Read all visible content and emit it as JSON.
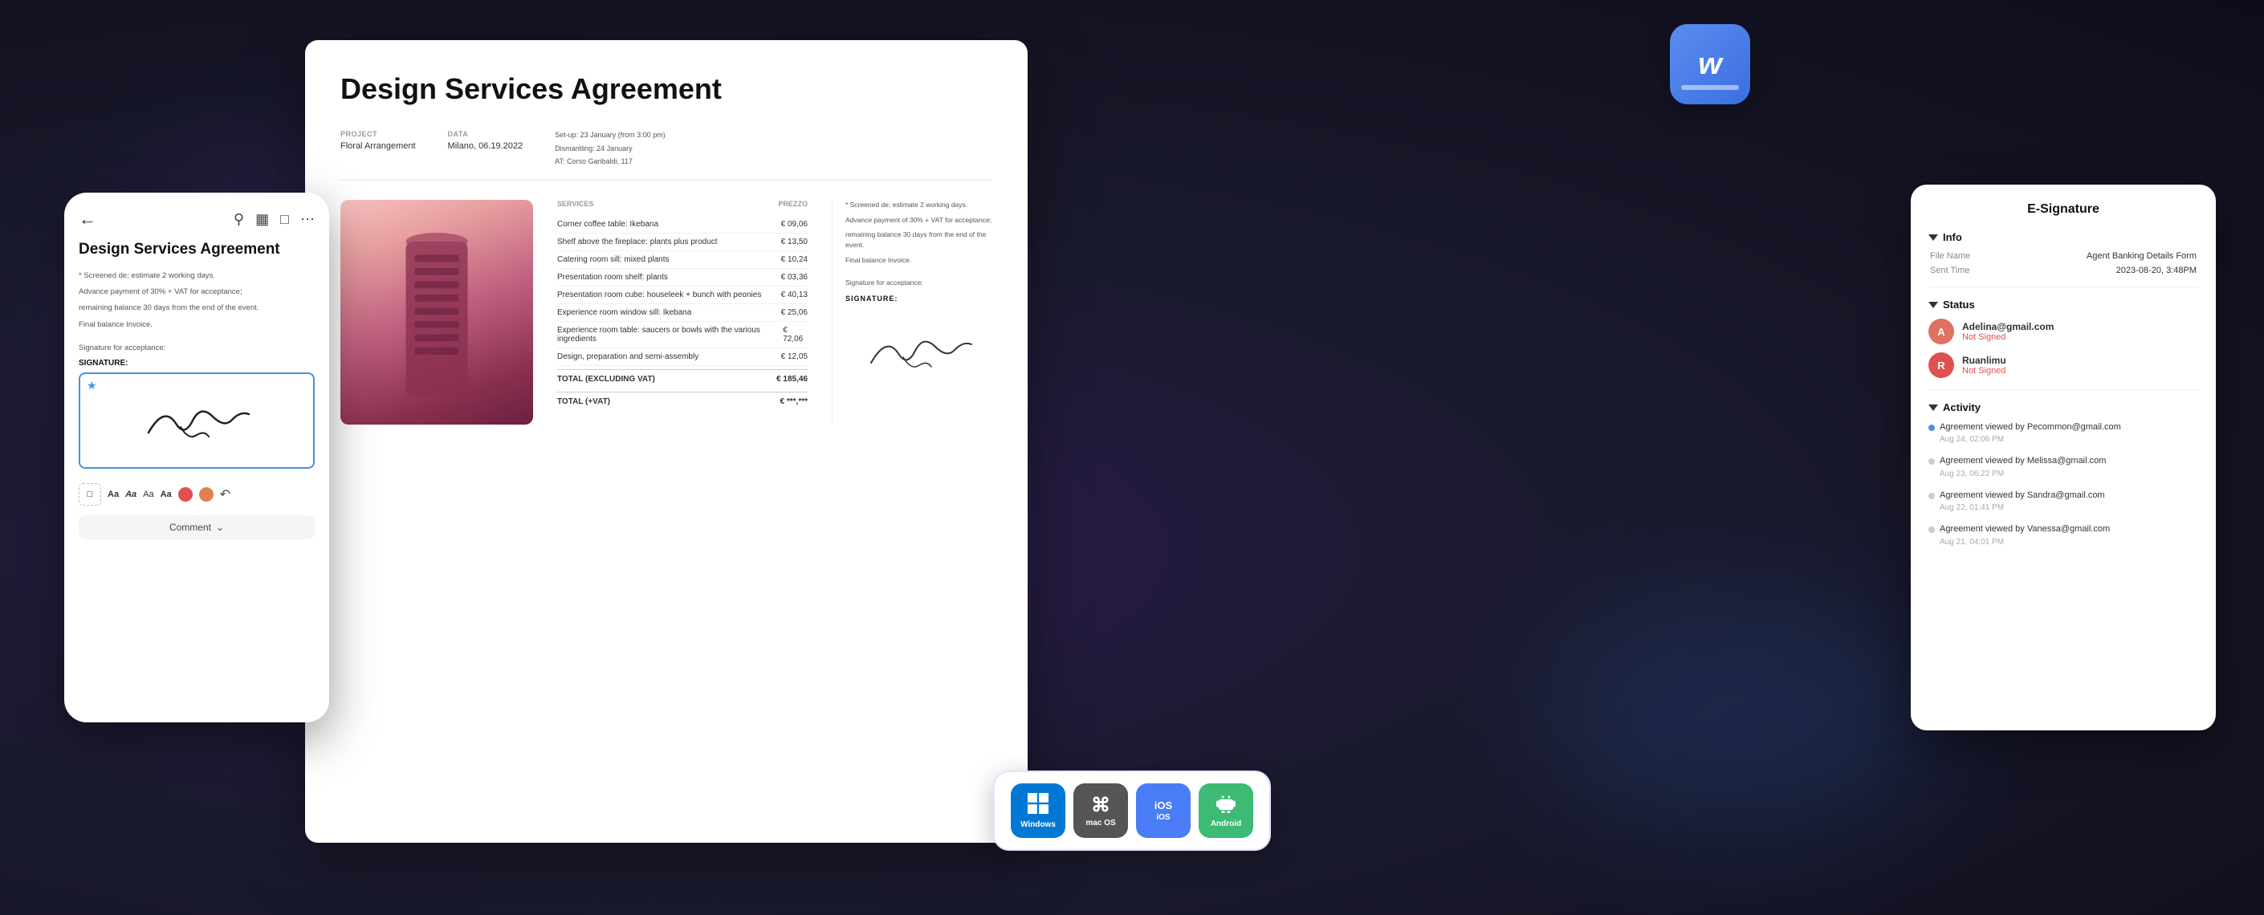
{
  "app": {
    "title": "Design Services Agreement"
  },
  "mobile": {
    "back_icon": "←",
    "title": "Design Services Agreement",
    "body_text_1": "* Screened de; estimate 2 working days.",
    "body_text_2": "Advance payment of 30% + VAT for acceptance;",
    "body_text_3": "remaining balance 30 days from the end of the event.",
    "body_text_4": "Final balance Invoice.",
    "sig_label": "Signature for acceptance:",
    "sig_section_title": "SIGNATURE:",
    "comment_label": "Comment",
    "toolbar_items": [
      "Aa",
      "Aa",
      "Aa",
      "Aa"
    ]
  },
  "document": {
    "title": "Design Services Agreement",
    "project_label": "PROJECT",
    "project_value": "Floral Arrangement",
    "data_label": "DATA",
    "data_value": "Milano, 06.19.2022",
    "setup_text": "Set-up: 23 January (from 3:00 pm)",
    "dismantling_text": "Dismantling: 24 January",
    "address_text": "AT: Corso Garibaldi, 117",
    "services_label": "SERVICES",
    "prezzo_label": "PREZZO",
    "services": [
      {
        "name": "Corner coffee table: Ikebana",
        "price": "€ 09,06"
      },
      {
        "name": "Shelf above the fireplace: plants plus product",
        "price": "€ 13,50"
      },
      {
        "name": "Catering room sill: mixed plants",
        "price": "€ 10,24"
      },
      {
        "name": "Presentation room shelf: plants",
        "price": "€ 03,36"
      },
      {
        "name": "Presentation room cube: houseleek + bunch with peonies",
        "price": "€ 40,13"
      },
      {
        "name": "Experience room window sill: Ikebana",
        "price": "€ 25,06"
      },
      {
        "name": "Experience room table: saucers or bowls with the various ingredients",
        "price": "€ 72,06"
      },
      {
        "name": "Design, preparation and semi-assembly",
        "price": "€ 12,05"
      }
    ],
    "total_excl_label": "TOTAL (EXCLUDING VAT)",
    "total_excl_value": "€ 185,46",
    "total_incl_label": "TOTAL (+VAT)",
    "total_incl_value": "€ ***,***",
    "body_text_1": "* Screened de; estimate 2 working days.",
    "body_text_2": "Advance payment of 30% + VAT for acceptance;",
    "body_text_3": "remaining balance 30 days from the end of the event.",
    "body_text_4": "Final balance Invoice.",
    "sig_label": "Signature for acceptance:",
    "sig_section_title": "SIGNATURE:"
  },
  "esignature": {
    "panel_title": "E-Signature",
    "info_section": "Info",
    "file_name_label": "File Name",
    "file_name_value": "Agent Banking Details Form",
    "sent_time_label": "Sent Time",
    "sent_time_value": "2023-08-20, 3:48PM",
    "status_section": "Status",
    "signers": [
      {
        "initial": "A",
        "email": "Adelina@gmail.com",
        "status": "Not Signed",
        "color": "avatar-a"
      },
      {
        "initial": "R",
        "email": "Ruanlimu",
        "status": "Not Signed",
        "color": "avatar-r"
      }
    ],
    "activity_section": "Activity",
    "activities": [
      {
        "text": "Agreement viewed by Pecommon@gmail.com",
        "time": "Aug 24, 02:06 PM",
        "active": true
      },
      {
        "text": "Agreement viewed by Melissa@gmail.com",
        "time": "Aug 23, 06:22 PM",
        "active": false
      },
      {
        "text": "Agreement viewed by Sandra@gmail.com",
        "time": "Aug 22, 01:41 PM",
        "active": false
      },
      {
        "text": "Agreement viewed by Vanessa@gmail.com",
        "time": "Aug 21, 04:01 PM",
        "active": false
      }
    ]
  },
  "platforms": [
    {
      "name": "windows",
      "icon": "⊞",
      "label": "Windows"
    },
    {
      "name": "macos",
      "icon": "⌘",
      "label": "mac OS"
    },
    {
      "name": "ios",
      "icon": "📱",
      "label": "iOS"
    },
    {
      "name": "android",
      "icon": "🤖",
      "label": "Android"
    }
  ]
}
